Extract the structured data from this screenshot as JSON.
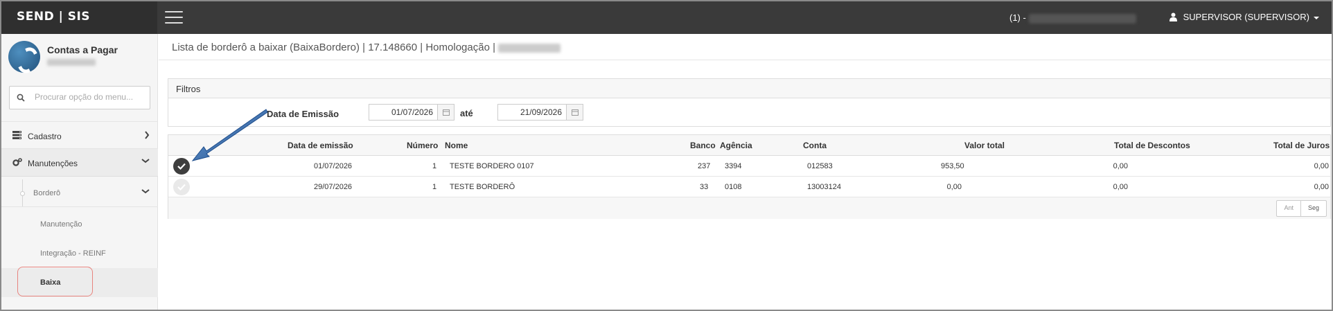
{
  "app": {
    "brand": "SEND | SIS",
    "environment_prefix": "(1) -",
    "user_label": "SUPERVISOR (SUPERVISOR)"
  },
  "sidebar": {
    "module_title": "Contas a Pagar",
    "search_placeholder": "Procurar opção do menu...",
    "items": [
      {
        "label": "Cadastro",
        "icon": "server-icon"
      },
      {
        "label": "Manutenções",
        "icon": "gears-icon"
      }
    ],
    "group": {
      "label": "Borderô"
    },
    "subitems": [
      {
        "label": "Manutenção"
      },
      {
        "label": "Integração - REINF"
      },
      {
        "label": "Baixa"
      }
    ]
  },
  "page": {
    "title": "Lista de borderô a baixar (BaixaBordero) | 17.148660 | Homologação |"
  },
  "filters": {
    "title": "Filtros",
    "date_label": "Data de Emissão",
    "date_from": "01/07/2026",
    "sep": "até",
    "date_to": "21/09/2026"
  },
  "table": {
    "columns": [
      "Data de emissão",
      "Número",
      "Nome",
      "Banco",
      "Agência",
      "Conta",
      "Valor total",
      "Total de Descontos",
      "Total de Juros"
    ],
    "rows": [
      {
        "selected": true,
        "data": "01/07/2026",
        "numero": "1",
        "nome": "TESTE BORDERO 0107",
        "banco": "237",
        "agencia": "3394",
        "conta": "012583",
        "valor": "953,50",
        "descontos": "0,00",
        "juros": "0,00"
      },
      {
        "selected": false,
        "data": "29/07/2026",
        "numero": "1",
        "nome": "TESTE BORDERÔ",
        "banco": "33",
        "agencia": "0108",
        "conta": "13003124",
        "valor": "0,00",
        "descontos": "0,00",
        "juros": "0,00"
      }
    ],
    "pager": {
      "prev": "Ant",
      "next": "Seg"
    }
  },
  "colors": {
    "topbar": "#3a3a3a",
    "highlight": "#e8847e",
    "arrow": "#1f4e8c"
  }
}
